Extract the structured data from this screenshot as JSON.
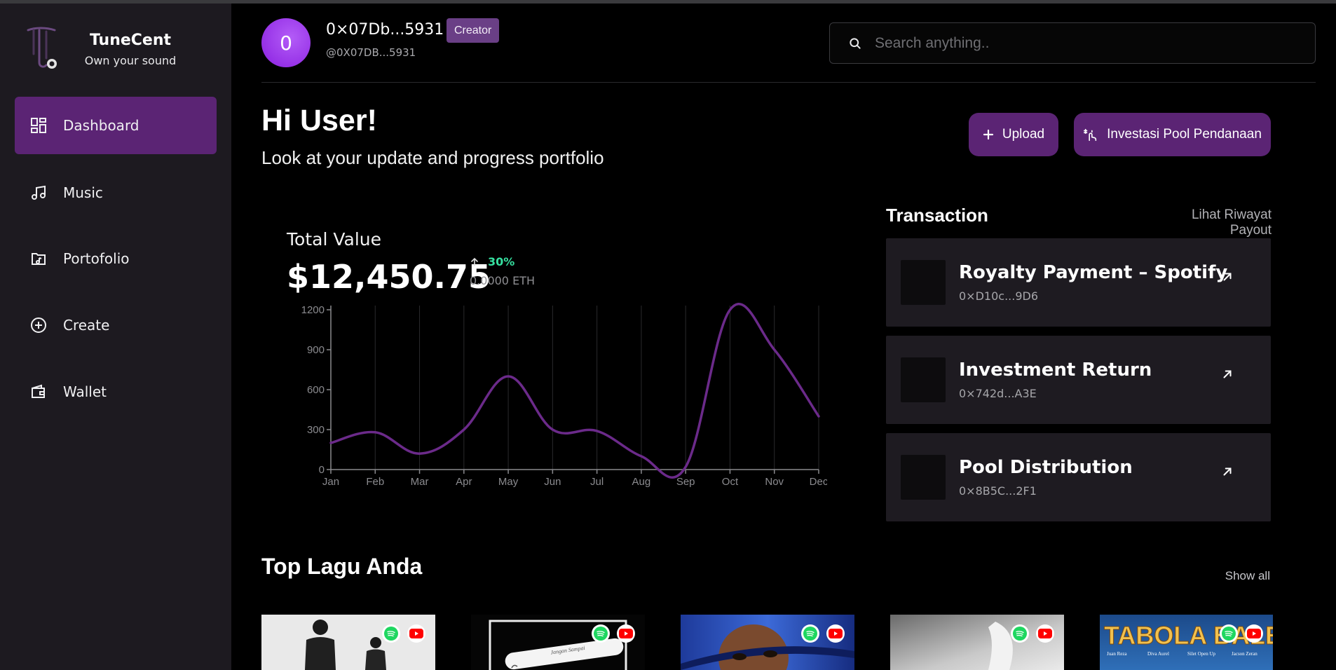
{
  "brand": {
    "name": "TuneCent",
    "tagline": "Own your sound"
  },
  "nav": [
    {
      "label": "Dashboard",
      "icon": "dashboard-icon",
      "active": true
    },
    {
      "label": "Music",
      "icon": "music-note-icon"
    },
    {
      "label": "Portofolio",
      "icon": "folder-music-icon"
    },
    {
      "label": "Create",
      "icon": "plus-circle-icon"
    },
    {
      "label": "Wallet",
      "icon": "wallet-icon"
    }
  ],
  "user": {
    "initial": "0",
    "address": "0×07Db...5931",
    "handle": "@0X07DB...5931",
    "role": "Creator"
  },
  "search": {
    "placeholder": "Search anything.."
  },
  "greeting": {
    "title": "Hi User!",
    "subtitle": "Look at your update and progress portfolio"
  },
  "actions": {
    "upload": "Upload",
    "invest": "Investasi Pool Pendanaan"
  },
  "total_value": {
    "label": "Total Value",
    "amount": "$12,450.75",
    "change": "30%",
    "eth": "0.0000 ETH"
  },
  "chart_data": {
    "type": "line",
    "categories": [
      "Jan",
      "Feb",
      "Mar",
      "Apr",
      "May",
      "Jun",
      "Jul",
      "Aug",
      "Sep",
      "Oct",
      "Nov",
      "Dec"
    ],
    "values": [
      200,
      280,
      120,
      300,
      700,
      300,
      290,
      100,
      20,
      1200,
      900,
      400
    ],
    "yticks": [
      0,
      300,
      600,
      900,
      1200
    ],
    "ylim": [
      0,
      1200
    ],
    "grid": "vertical",
    "color": "#6b2a8a"
  },
  "transactions": {
    "title": "Transaction",
    "link": "Lihat Riwayat Payout",
    "items": [
      {
        "name": "Royalty Payment – Spotify",
        "hash": "0×D10c...9D6"
      },
      {
        "name": "Investment Return",
        "hash": "0×742d...A3E"
      },
      {
        "name": "Pool Distribution",
        "hash": "0×8B5C...2F1"
      }
    ]
  },
  "top_songs": {
    "title": "Top Lagu Anda",
    "link": "Show all",
    "cover_text": "TABOLA BALE",
    "cover_names": [
      "Juan Reza",
      "Diva Aurel",
      "Silet Open Up",
      "Jacson Zeran"
    ],
    "cover_handwriting": "Jangan Sampai"
  },
  "colors": {
    "accent": "#5b2474",
    "sidebar": "#1d1a20",
    "card": "#1e1b21",
    "positive": "#36e0a0"
  }
}
